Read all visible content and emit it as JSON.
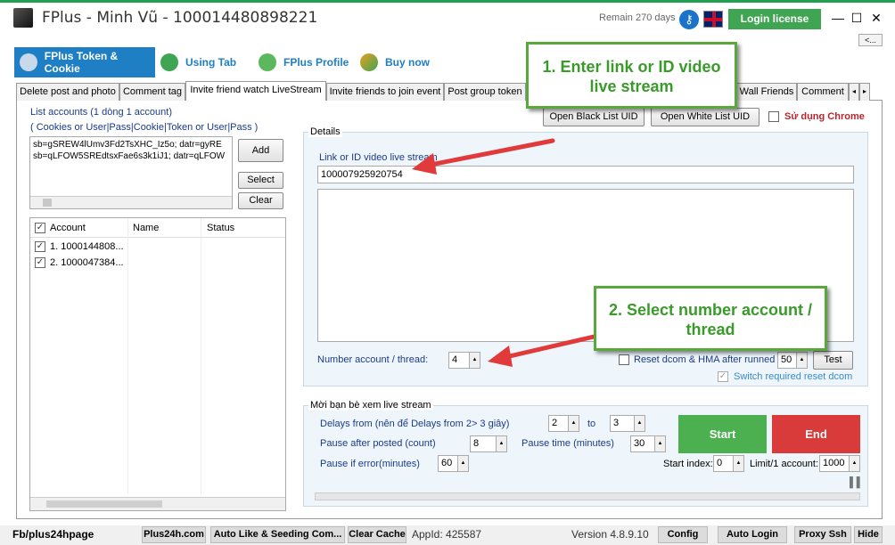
{
  "titlebar": {
    "title": "FPlus - Minh Vũ - 100014480898221",
    "remain": "Remain 270 days",
    "login_license": "Login license",
    "minimize": "—",
    "maximize": "☐",
    "close": "✕"
  },
  "collapse_label": "<...",
  "top_tabs": [
    {
      "label": "FPlus Token & Cookie",
      "icon": "key-icon"
    },
    {
      "label": "Using Tab",
      "icon": "link-icon"
    },
    {
      "label": "FPlus Profile",
      "icon": "people-icon"
    },
    {
      "label": "Buy now",
      "icon": "refresh-icon"
    }
  ],
  "sub_tabs": [
    "Delete post and photo",
    "Comment tag",
    "Invite friend watch LiveStream",
    "Invite friends to join event",
    "Post group token",
    "Wall Friends",
    "Comment"
  ],
  "accounts": {
    "title": "List accounts (1 dòng 1 account)",
    "hint": "( Cookies or User|Pass|Cookie|Token or User|Pass )",
    "lines": [
      "sb=gSREW4lUmv3Fd2TsXHC_Iz5o; datr=gyRE",
      "sb=qLFOW5SREdtsxFae6s3k1iJ1; datr=qLFOW"
    ],
    "add": "Add",
    "select": "Select",
    "clear": "Clear",
    "columns": [
      "Account",
      "Name",
      "Status"
    ],
    "rows": [
      "1. 1000144808...",
      "2. 1000047384..."
    ]
  },
  "blacklist": {
    "open_black": "Open Black List UID",
    "open_white": "Open White List UID",
    "use_chrome": "Sử dụng Chrome"
  },
  "details": {
    "title": "Details",
    "link_label": "Link or ID video live stream",
    "link_value": "100007925920754",
    "number_label": "Number account / thread:",
    "number_value": "4",
    "reset_label": "Reset dcom & HMA after runned",
    "reset_value": "50",
    "test": "Test",
    "switch_label": "Switch required reset dcom"
  },
  "invite": {
    "title": "Mời bạn bè xem live stream",
    "delays_label": "Delays from (nên để Delays from 2> 3 giây)",
    "delay_from": "2",
    "to": "to",
    "delay_to": "3",
    "pause_posted_label": "Pause after posted (count)",
    "pause_posted": "8",
    "pause_time_label": "Pause time (minutes)",
    "pause_time": "30",
    "pause_error_label": "Pause if error(minutes)",
    "pause_error": "60",
    "start": "Start",
    "end": "End",
    "start_index_label": "Start index:",
    "start_index": "0",
    "limit_label": "Limit/1 account:",
    "limit": "1000"
  },
  "callouts": {
    "one": "1. Enter link or ID video live stream",
    "two": "2. Select number account / thread"
  },
  "statusbar": {
    "page": "Fb/plus24hpage",
    "buttons": [
      "Plus24h.com",
      "Auto Like & Seeding Com...",
      "Clear Cache"
    ],
    "appid": "AppId: 425587",
    "version": "Version 4.8.9.10",
    "right_buttons": [
      "Config",
      "Auto Login",
      "Proxy Ssh",
      "Hide"
    ]
  },
  "colors": {
    "accent": "#1f7fc4",
    "green": "#3fa552",
    "red": "#d93a3a",
    "callout": "#58a83c"
  }
}
